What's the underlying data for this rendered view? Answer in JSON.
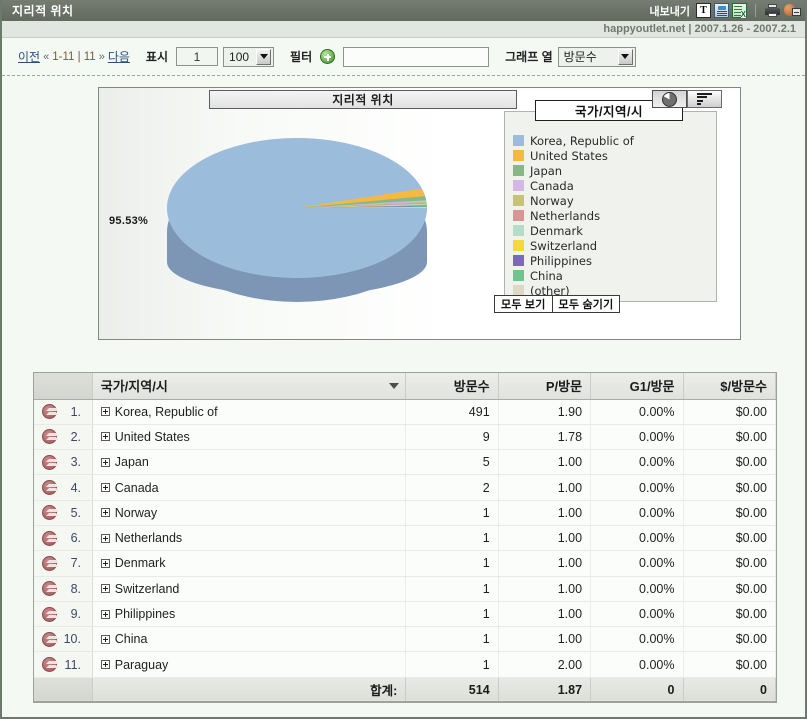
{
  "titlebar": {
    "title": "지리적 위치",
    "export_label": "내보내기",
    "icons": {
      "text": "T",
      "doc": "document-export-icon",
      "excel": "excel-export-icon",
      "print": "printer-icon",
      "help": "help-icon"
    }
  },
  "subheader": {
    "text": "happyoutlet.net  |  2007.1.26 - 2007.2.1"
  },
  "toolbar": {
    "prev_label": "이전",
    "prev_chevron": "«",
    "page_range": "1-11 | 11",
    "next_chevron": "»",
    "next_label": "다음",
    "display_label": "표시",
    "display_value": "1",
    "rows_value": "100",
    "filter_label": "필터",
    "filter_value": "",
    "filter_placeholder": "",
    "graph_col_label": "그래프 열",
    "graph_col_value": "방문수"
  },
  "chart": {
    "title": "지리적 위치",
    "percent_label": "95.53%",
    "legend_title": "국가/지역/시",
    "show_all_label": "모두 보기",
    "hide_all_label": "모두 숨기기",
    "type_pie": "pie-chart-icon",
    "type_bar": "bar-chart-icon"
  },
  "table": {
    "headers": {
      "rank": "",
      "name": "국가/지역/시",
      "visits": "방문수",
      "pageviews": "P/방문",
      "goal": "G1/방문",
      "value": "$/방문수"
    },
    "rows": [
      {
        "rank": "1.",
        "name": "Korea, Republic of",
        "visits": "491",
        "pageviews": "1.90",
        "goal": "0.00%",
        "value": "$0.00"
      },
      {
        "rank": "2.",
        "name": "United States",
        "visits": "9",
        "pageviews": "1.78",
        "goal": "0.00%",
        "value": "$0.00"
      },
      {
        "rank": "3.",
        "name": "Japan",
        "visits": "5",
        "pageviews": "1.00",
        "goal": "0.00%",
        "value": "$0.00"
      },
      {
        "rank": "4.",
        "name": "Canada",
        "visits": "2",
        "pageviews": "1.00",
        "goal": "0.00%",
        "value": "$0.00"
      },
      {
        "rank": "5.",
        "name": "Norway",
        "visits": "1",
        "pageviews": "1.00",
        "goal": "0.00%",
        "value": "$0.00"
      },
      {
        "rank": "6.",
        "name": "Netherlands",
        "visits": "1",
        "pageviews": "1.00",
        "goal": "0.00%",
        "value": "$0.00"
      },
      {
        "rank": "7.",
        "name": "Denmark",
        "visits": "1",
        "pageviews": "1.00",
        "goal": "0.00%",
        "value": "$0.00"
      },
      {
        "rank": "8.",
        "name": "Switzerland",
        "visits": "1",
        "pageviews": "1.00",
        "goal": "0.00%",
        "value": "$0.00"
      },
      {
        "rank": "9.",
        "name": "Philippines",
        "visits": "1",
        "pageviews": "1.00",
        "goal": "0.00%",
        "value": "$0.00"
      },
      {
        "rank": "10.",
        "name": "China",
        "visits": "1",
        "pageviews": "1.00",
        "goal": "0.00%",
        "value": "$0.00"
      },
      {
        "rank": "11.",
        "name": "Paraguay",
        "visits": "1",
        "pageviews": "2.00",
        "goal": "0.00%",
        "value": "$0.00"
      }
    ],
    "totals": {
      "label": "합계:",
      "visits": "514",
      "pageviews": "1.87",
      "goal": "0",
      "value": "0"
    }
  },
  "chart_data": {
    "type": "pie",
    "title": "지리적 위치",
    "legend_title": "국가/지역/시",
    "legend_position": "right",
    "labels": [
      "Korea, Republic of",
      "United States",
      "Japan",
      "Canada",
      "Norway",
      "Netherlands",
      "Denmark",
      "Switzerland",
      "Philippines",
      "China",
      "(other)"
    ],
    "values": [
      491,
      9,
      5,
      2,
      1,
      1,
      1,
      1,
      1,
      1,
      1
    ],
    "percentages": [
      95.53,
      1.75,
      0.97,
      0.39,
      0.19,
      0.19,
      0.19,
      0.19,
      0.19,
      0.19,
      0.19
    ],
    "colors": [
      "#9cbcdc",
      "#f4b942",
      "#86b986",
      "#d6b6e2",
      "#c7c179",
      "#d99595",
      "#b4ddc9",
      "#f7d83a",
      "#7b6ab9",
      "#6ec58e",
      "#ddd9c4"
    ],
    "annotations": [
      "95.53%"
    ],
    "total": 514
  }
}
